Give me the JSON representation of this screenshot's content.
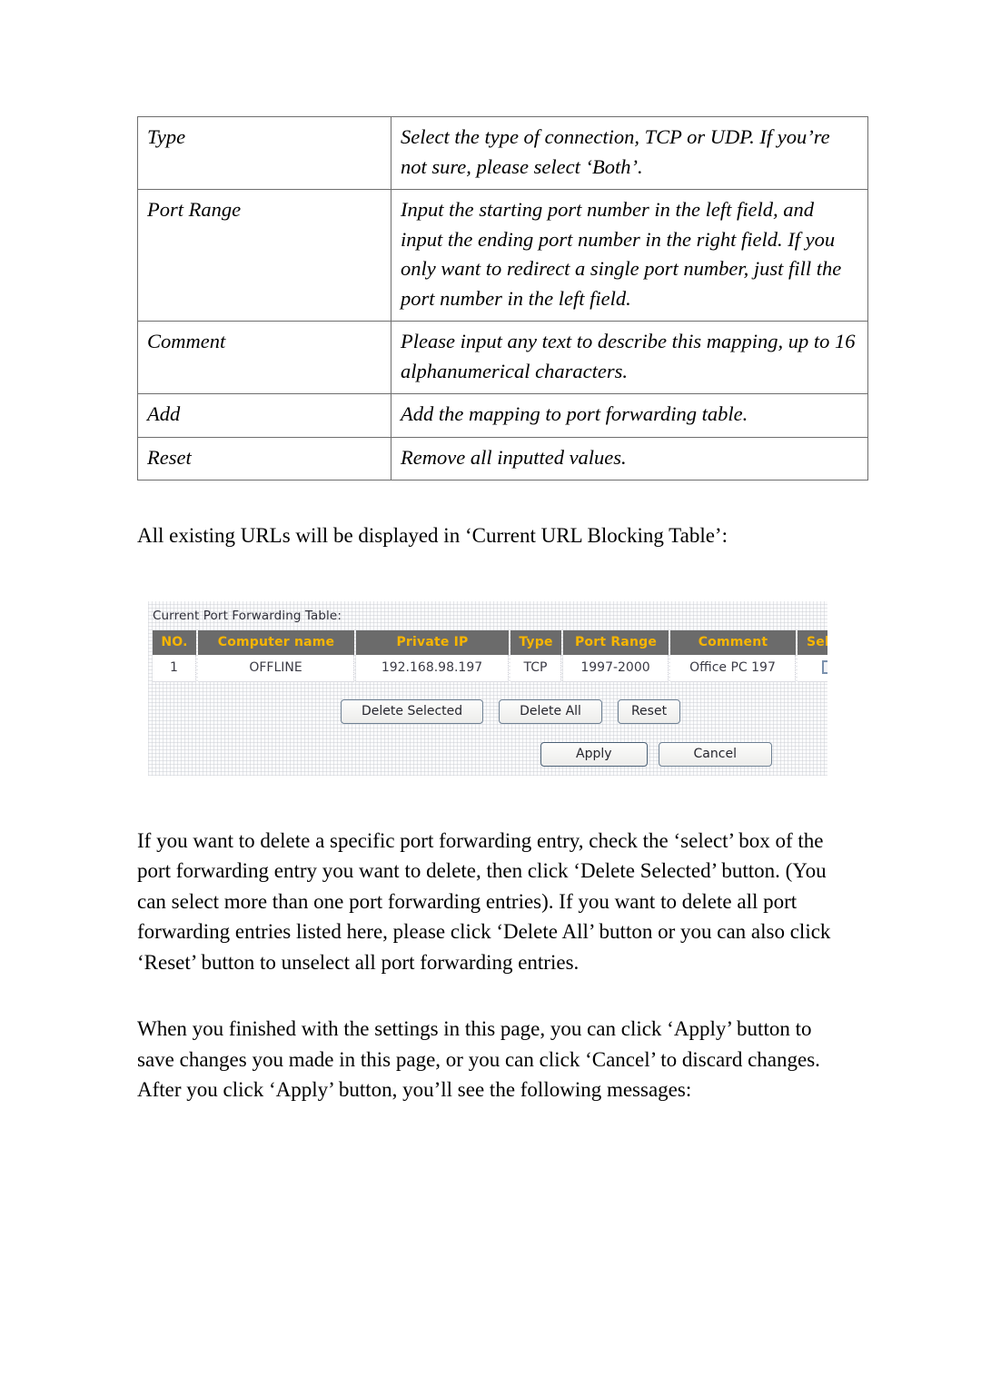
{
  "definition_table": {
    "rows": [
      {
        "term": "Type",
        "desc": "Select the type of connection, TCP or UDP. If you’re not sure, please select ‘Both’."
      },
      {
        "term": "Port Range",
        "desc": "Input the starting port number in the left field, and input the ending port number in the right field. If you only want to redirect a single port number, just fill the port number in the left field."
      },
      {
        "term": "Comment",
        "desc": "Please input any text to describe this mapping, up to 16 alphanumerical characters."
      },
      {
        "term": "Add",
        "desc": "Add the mapping to port forwarding table."
      },
      {
        "term": "Reset",
        "desc": "Remove all inputted values."
      }
    ]
  },
  "paragraphs": {
    "intro": "All existing URLs will be displayed in ‘Current URL Blocking Table’:",
    "delete_info": "If you want to delete a specific port forwarding entry, check the ‘select’ box of the port forwarding entry you want to delete, then click ‘Delete Selected’ button. (You can select more than one port forwarding entries). If you want to delete all port forwarding entries listed here, please click ‘Delete All’ button or you can also click ‘Reset’ button to unselect all port forwarding entries.",
    "apply_info": "When you finished with the settings in this page, you can click ‘Apply’ button to save changes you made in this page, or you can click ‘Cancel’ to discard changes. After you click ‘Apply’ button, you’ll see the following messages:"
  },
  "screenshot": {
    "label": "Current Port Forwarding Table:",
    "colors": {
      "header_bg": "#6b6b6b",
      "header_text": "#f7b500",
      "cell_text": "#3a3a44",
      "checkbox_border": "#7a90ad",
      "button_border": "#6e8093"
    },
    "table": {
      "headers": [
        "NO.",
        "Computer name",
        "Private IP",
        "Type",
        "Port Range",
        "Comment",
        "Select"
      ],
      "rows": [
        {
          "no": "1",
          "computer_name": "OFFLINE",
          "private_ip": "192.168.98.197",
          "type": "TCP",
          "port_range": "1997-2000",
          "comment": "Office PC 197",
          "selected": false
        }
      ]
    },
    "buttons": {
      "delete_selected": "Delete Selected",
      "delete_all": "Delete All",
      "reset": "Reset",
      "apply": "Apply",
      "cancel": "Cancel"
    }
  }
}
